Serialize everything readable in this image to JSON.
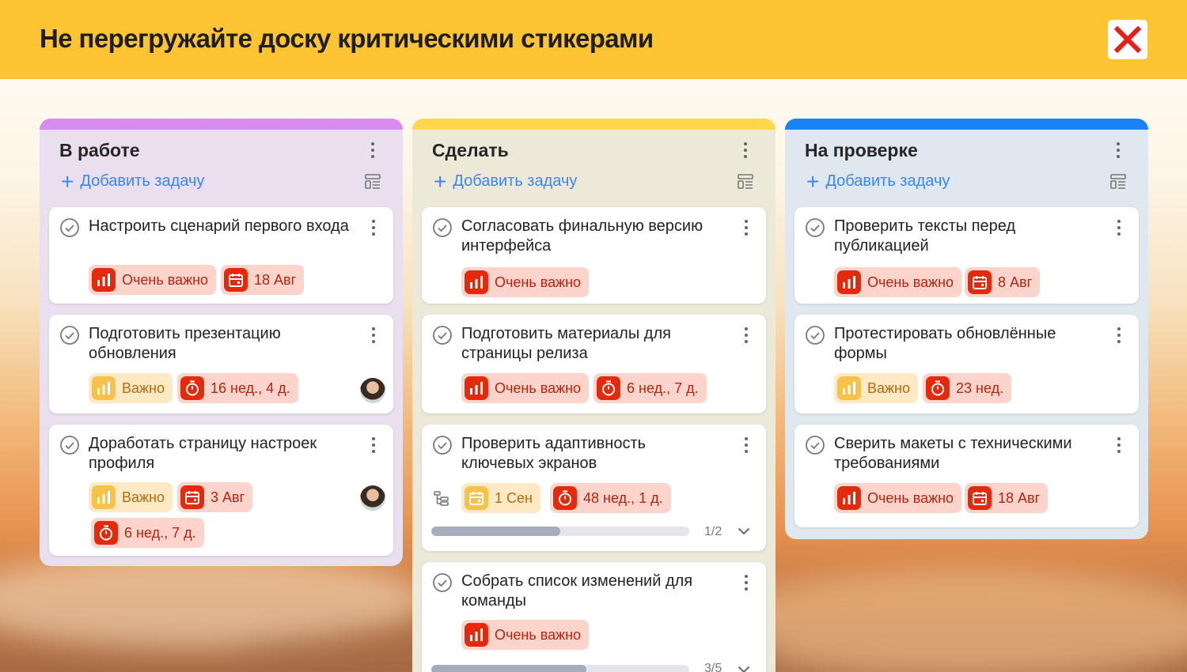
{
  "header": {
    "title": "Не перегружайте доску критическими стикерами",
    "close_icon": "red-cross-icon"
  },
  "colors": {
    "header_bg": "#ffc433",
    "col1_accent": "#d98cf0",
    "col2_accent": "#ffd74a",
    "col3_accent": "#1a82f5",
    "critical": "#e5290d",
    "important": "#f6c24b",
    "link": "#3b86f0"
  },
  "columns": [
    {
      "title": "В работе",
      "add_label": "Добавить задачу",
      "cards": [
        {
          "title": "Настроить сценарий первого входа",
          "tags": [
            {
              "kind": "priority",
              "label": "Очень важно"
            },
            {
              "kind": "date",
              "label": "18 Авг"
            }
          ]
        },
        {
          "title": "Подготовить презентацию обновления",
          "tags": [
            {
              "kind": "priority-medium",
              "label": "Важно"
            },
            {
              "kind": "timer",
              "label": "16  нед., 4 д."
            }
          ],
          "avatar": true
        },
        {
          "title": "Доработать страницу настроек профиля",
          "tags": [
            {
              "kind": "priority-medium",
              "label": "Важно"
            },
            {
              "kind": "date",
              "label": "3 Авг"
            },
            {
              "kind": "timer",
              "label": "6  нед., 7 д."
            }
          ],
          "avatar": true
        }
      ]
    },
    {
      "title": "Сделать",
      "add_label": "Добавить задачу",
      "cards": [
        {
          "title": "Согласовать финальную версию интерфейса",
          "tags": [
            {
              "kind": "priority",
              "label": "Очень важно"
            }
          ]
        },
        {
          "title": "Подготовить материалы для страницы релиза",
          "tags": [
            {
              "kind": "priority",
              "label": "Очень важно"
            },
            {
              "kind": "timer",
              "label": "6  нед., 7 д."
            }
          ]
        },
        {
          "title": "Проверить адаптивность ключевых экранов",
          "tags": [
            {
              "kind": "date-yellow",
              "label": "1 Сен"
            },
            {
              "kind": "timer",
              "label": "48  нед., 1 д."
            }
          ],
          "subtasks": {
            "text": "1/2",
            "done": 1,
            "total": 2
          }
        },
        {
          "title": "Собрать список изменений для команды",
          "tags": [
            {
              "kind": "priority",
              "label": "Очень важно"
            }
          ],
          "subtasks": {
            "text": "3/5",
            "done": 3,
            "total": 5
          }
        }
      ]
    },
    {
      "title": "На проверке",
      "add_label": "Добавить задачу",
      "cards": [
        {
          "title": "Проверить тексты перед публикацией",
          "tags": [
            {
              "kind": "priority",
              "label": "Очень важно"
            },
            {
              "kind": "date",
              "label": "8 Авг"
            }
          ]
        },
        {
          "title": "Протестировать обновлённые формы",
          "tags": [
            {
              "kind": "priority-medium",
              "label": "Важно"
            },
            {
              "kind": "timer",
              "label": "23  нед."
            }
          ]
        },
        {
          "title": "Сверить макеты с техническими требованиями",
          "tags": [
            {
              "kind": "priority",
              "label": "Очень важно"
            },
            {
              "kind": "date",
              "label": "18 Авг"
            }
          ]
        }
      ]
    }
  ]
}
